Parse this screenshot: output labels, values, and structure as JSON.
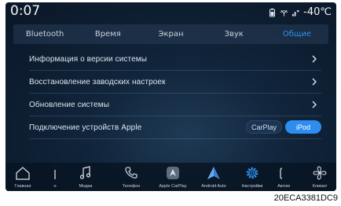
{
  "status": {
    "time": "0:07",
    "temperature": "-40℃",
    "icons": [
      "battery-icon",
      "wireless-icon",
      "signal-icon"
    ]
  },
  "tabs": [
    {
      "label": "Bluetooth",
      "active": false
    },
    {
      "label": "Время",
      "active": false
    },
    {
      "label": "Экран",
      "active": false
    },
    {
      "label": "Звук",
      "active": false
    },
    {
      "label": "Общие",
      "active": true
    }
  ],
  "settings": {
    "items": [
      {
        "label": "Информация о версии системы"
      },
      {
        "label": "Восстановление заводских настроек"
      },
      {
        "label": "Обновление системы"
      },
      {
        "label": "Подключение устройств Apple"
      }
    ],
    "apple_options": {
      "carplay": "CarPlay",
      "ipod": "iPod",
      "selected": "iPod"
    }
  },
  "dock": {
    "items": [
      {
        "label": "Главная",
        "icon": "home-icon"
      },
      {
        "label": "o",
        "icon": "fm-icon"
      },
      {
        "label": "Медиа",
        "icon": "music-note-icon"
      },
      {
        "label": "Телефон",
        "icon": "phone-icon"
      },
      {
        "label": "Apple CarPlay",
        "icon": "carplay-icon"
      },
      {
        "label": "Android Auto",
        "icon": "android-auto-icon"
      },
      {
        "label": "Настройки",
        "icon": "gear-icon",
        "active": true
      },
      {
        "label": "Автом",
        "icon": "car-icon"
      },
      {
        "label": "Климат",
        "icon": "fan-icon"
      }
    ]
  },
  "caption": "20ECA3381DC9",
  "colors": {
    "accent": "#2e8ff0",
    "background": "#10243a"
  }
}
